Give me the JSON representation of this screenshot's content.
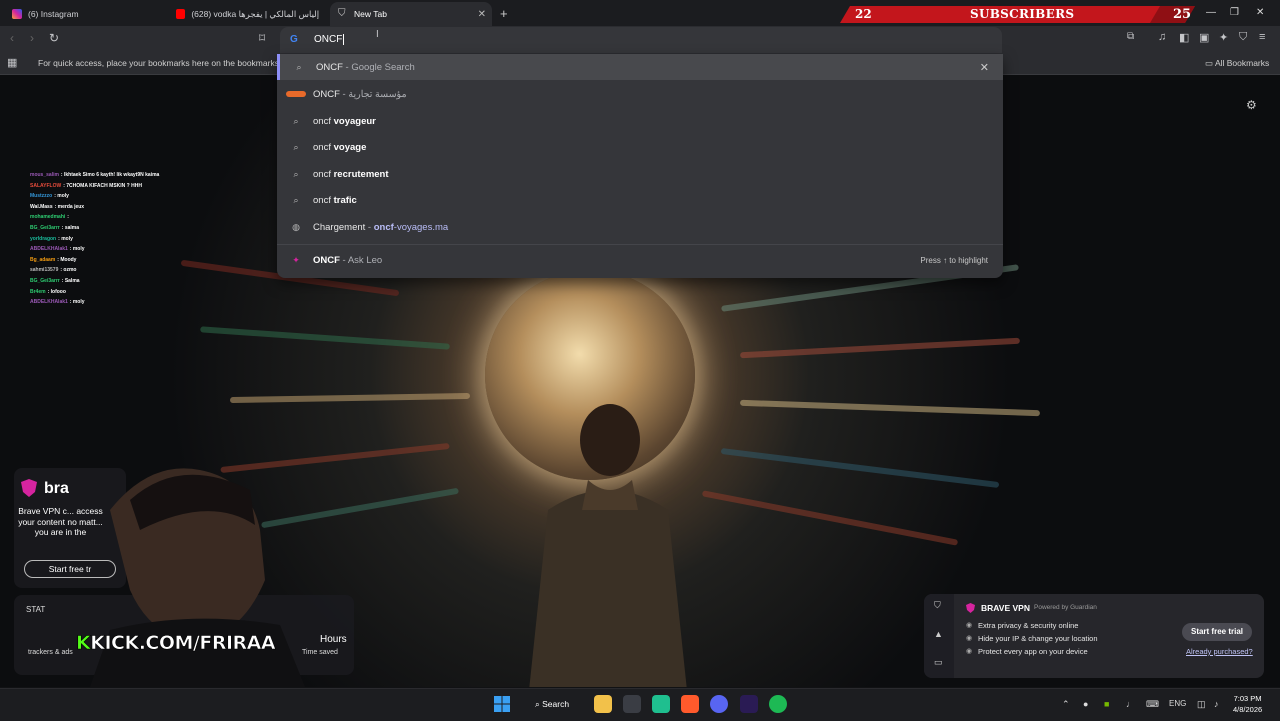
{
  "tabs": [
    {
      "title": "(6) Instagram"
    },
    {
      "title": "(628) vodka مع إلياس المالكي | يفجرها"
    },
    {
      "title": "New Tab",
      "active": true
    }
  ],
  "subscriber_bar": {
    "count_left": "22",
    "label": "SUBSCRIBERS",
    "count_right": "25"
  },
  "omnibox": {
    "text": "ONCF"
  },
  "bookmarks_bar": {
    "message": "For quick access, place your bookmarks here on the bookmarks bar.",
    "all_bookmarks": "All Bookmarks"
  },
  "suggestions": [
    {
      "icon": "search-icon",
      "main": "ONCF",
      "sep": " - ",
      "secondary": "Google Search",
      "bold": ""
    },
    {
      "icon": "site-logo-icon",
      "main": "ONCF",
      "sep": " - ",
      "secondary": "مؤسسة تجارية",
      "bold": ""
    },
    {
      "icon": "search-icon",
      "main": "oncf ",
      "bold": "voyageur"
    },
    {
      "icon": "search-icon",
      "main": "oncf ",
      "bold": "voyage"
    },
    {
      "icon": "search-icon",
      "main": "oncf ",
      "bold": "recrutement"
    },
    {
      "icon": "search-icon",
      "main": "oncf ",
      "bold": "trafic"
    },
    {
      "icon": "globe-icon",
      "main": "Chargement",
      "sep": " - ",
      "bold": "oncf",
      "secondary": "-voyages.ma"
    }
  ],
  "ask_leo": {
    "main": "ONCF",
    "secondary": "Ask Leo",
    "hint": "Press ↑ to highlight"
  },
  "chat": [
    {
      "user": "mous_salim",
      "msg": "lkhtaek Simo 6 kayth! lik wkayt9N kaima",
      "color": "#9b59b6"
    },
    {
      "user": "SALAYFLOW",
      "msg": "7CHOMA KIFACH MSKIN ? HHH",
      "color": "#e74c3c"
    },
    {
      "user": "Mustzzzo",
      "msg": "moly",
      "color": "#3498db"
    },
    {
      "user": "Wal.Mass",
      "msg": "merda jeux",
      "color": "#ffffff"
    },
    {
      "user": "mohamedmahi",
      "msg": "",
      "color": "#2ecc71"
    },
    {
      "user": "BG_Gei3arrr",
      "msg": "salma",
      "color": "#2ecc71"
    },
    {
      "user": "yorldragon",
      "msg": "moly",
      "color": "#1abc9c"
    },
    {
      "user": "ABDELKHAlak1",
      "msg": "moly",
      "color": "#9b59b6"
    },
    {
      "user": "Bg_adaam",
      "msg": "Moody",
      "color": "#f39c12"
    },
    {
      "user": "sahmi13579",
      "msg": "ozmo",
      "color": "#bbbbbb"
    },
    {
      "user": "BG_Gei3arrr",
      "msg": "Salma",
      "color": "#2ecc71"
    },
    {
      "user": "Br4em",
      "msg": "lofooo",
      "color": "#2ecc71"
    },
    {
      "user": "ABDELKHAlak1",
      "msg": "moly",
      "color": "#9b59b6"
    }
  ],
  "vpn_left": {
    "brand": "bra",
    "desc": "Brave VPN c... access your content no matt... you are in the",
    "button": "Start free tr"
  },
  "stats": {
    "label": "STAT",
    "hours": "Hours",
    "trackers": "trackers & ads",
    "time_saved": "Time saved"
  },
  "kick": {
    "k": "K",
    "text": "KICK.COM/FRIRAA"
  },
  "vpn_right": {
    "title": "BRAVE VPN",
    "powered": "Powered by  Guardian",
    "items": [
      "Extra privacy & security online",
      "Hide your IP & change your location",
      "Protect every app on your device"
    ],
    "button": "Start free trial",
    "link": "Already purchased?"
  },
  "taskbar": {
    "search": "Search",
    "lang": "ENG",
    "time": "7:03 PM",
    "date": "4/8/2026"
  }
}
